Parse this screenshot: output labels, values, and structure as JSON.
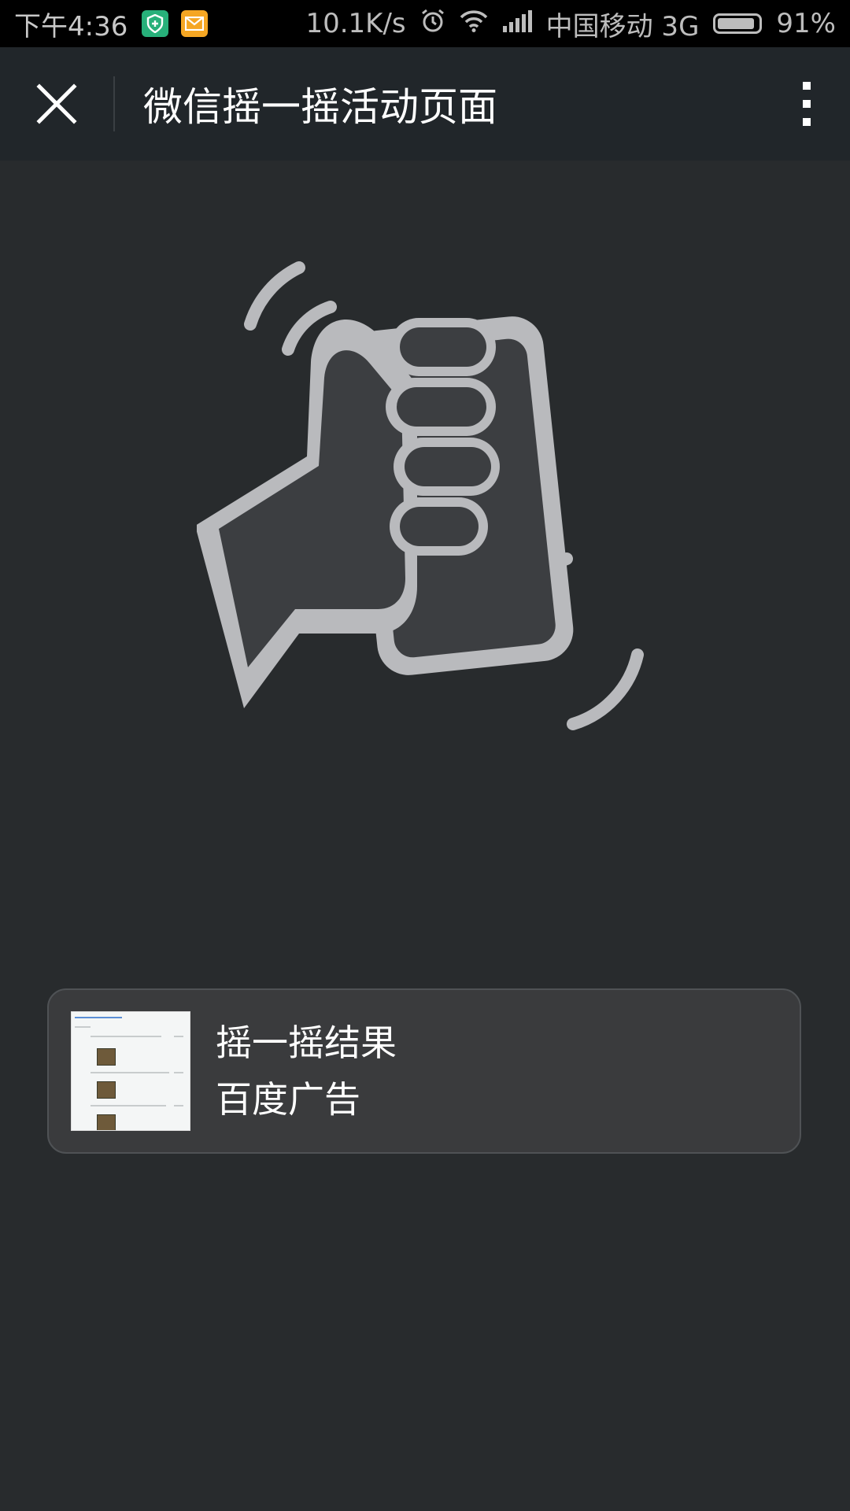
{
  "status_bar": {
    "time": "下午4:36",
    "net_speed": "10.1K/s",
    "carrier": "中国移动 3G",
    "battery": "91%",
    "battery_level": 0.91,
    "icons": [
      "shield-app-icon",
      "mail-app-icon",
      "alarm-icon",
      "wifi-icon",
      "signal-icon",
      "battery-icon"
    ]
  },
  "navbar": {
    "title": "微信摇一摇活动页面",
    "close_icon": "close-icon",
    "more_icon": "more-vertical-icon"
  },
  "main": {
    "graphic_icon": "shake-phone-hand-icon"
  },
  "result_card": {
    "title": "摇一摇结果",
    "subtitle": "百度广告"
  },
  "colors": {
    "background": "#282b2d",
    "navbar": "#21262a",
    "status_bar": "#000000",
    "card_bg": "#3a3b3d",
    "icon_gray": "#b9babd"
  }
}
